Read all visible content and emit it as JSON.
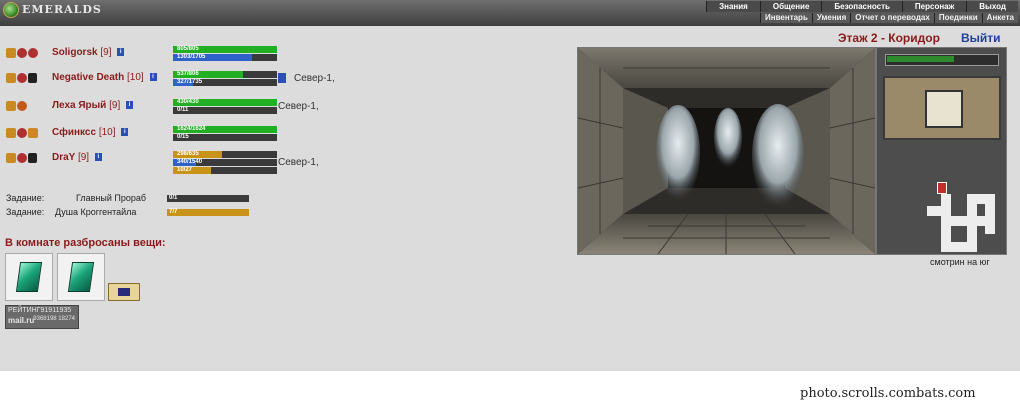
{
  "brand": "EMERALDS",
  "menu": {
    "top": [
      "Знания",
      "Общение",
      "Безопасность",
      "Персонаж",
      "Выход"
    ],
    "bottom": [
      "Инвентарь",
      "Умения",
      "Отчет о переводах",
      "Поединки",
      "Анкета"
    ]
  },
  "location": {
    "title": "Этаж 2 - Коридор",
    "exit": "Выйти"
  },
  "party": [
    {
      "name": "Soligorsk",
      "level": "[9]",
      "hp": "805/805",
      "hp_fill": 1.0,
      "mp": "1303/1705",
      "mp_fill": 0.76,
      "location": ""
    },
    {
      "name": "Negative Death",
      "level": "[10]",
      "hp": "537/806",
      "hp_fill": 0.67,
      "mp": "327/1735",
      "mp_fill": 0.19,
      "location": "Север-1,"
    },
    {
      "name": "Леха Ярый",
      "level": "[9]",
      "hp": "430/430",
      "hp_fill": 1.0,
      "mp": "0/11",
      "mp_fill": 0.0,
      "location": "Север-1,"
    },
    {
      "name": "Сфинксс",
      "level": "[10]",
      "hp": "1624/1624",
      "hp_fill": 1.0,
      "mp": "0/15",
      "mp_fill": 0.0,
      "location": ""
    },
    {
      "name": "DraY",
      "level": "[9]",
      "hp": "298/635",
      "hp_fill": 0.47,
      "mp": "340/1540",
      "mp_fill": 0.22,
      "sp": "10/27",
      "sp_fill": 0.37,
      "location": "Север-1,"
    }
  ],
  "quests": [
    {
      "label": "Задание:",
      "name": "Главный Прораб",
      "progress": "0/1",
      "fill": 0.0
    },
    {
      "label": "Задание:",
      "name": "Душа Кроггентайла",
      "progress": "7/7",
      "fill": 1.0
    }
  ],
  "items_title": "В комнате разбросаны вещи:",
  "items": [
    {
      "icon": "emerald-icon"
    },
    {
      "icon": "emerald-icon"
    }
  ],
  "counter": {
    "line1": "РЕЙТИНГ91911935",
    "logo": "mail.ru",
    "stats": "9368198 18274"
  },
  "look_direction": "смотрин на юг",
  "footer": "photo.scrolls.combats.com",
  "colors": {
    "accent": "#8b1a1a",
    "link": "#1f3f9f",
    "hp": "#22b022",
    "mp": "#2f62c9"
  }
}
